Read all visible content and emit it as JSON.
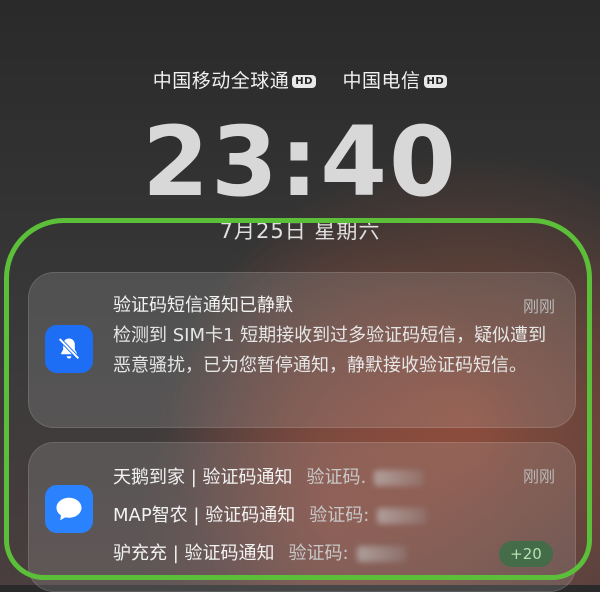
{
  "status": {
    "carriers": [
      {
        "name": "中国移动全球通",
        "badge": "HD"
      },
      {
        "name": "中国电信",
        "badge": "HD"
      }
    ]
  },
  "lockscreen": {
    "time": "23:40",
    "date": "7月25日 星期六"
  },
  "notifications": [
    {
      "title": "验证码短信通知已静默",
      "time": "刚刚",
      "body": "检测到 SIM卡1 短期接收到过多验证码短信，疑似遭到恶意骚扰，已为您暂停通知，静默接收验证码短信。",
      "icon": "bell-off-icon",
      "icon_color": "#1e6ef5"
    },
    {
      "time": "刚刚",
      "icon": "message-bubble-icon",
      "icon_color": "#2a82ff",
      "messages": [
        {
          "sender": "天鹅到家 | 验证码通知",
          "preview": "验证码."
        },
        {
          "sender": "MAP智农 | 验证码通知",
          "preview": "验证码:"
        },
        {
          "sender": "驴充充 | 验证码通知",
          "preview": "验证码:"
        }
      ],
      "more_count": "+20"
    }
  ],
  "colors": {
    "highlight": "#5cbf3a"
  }
}
